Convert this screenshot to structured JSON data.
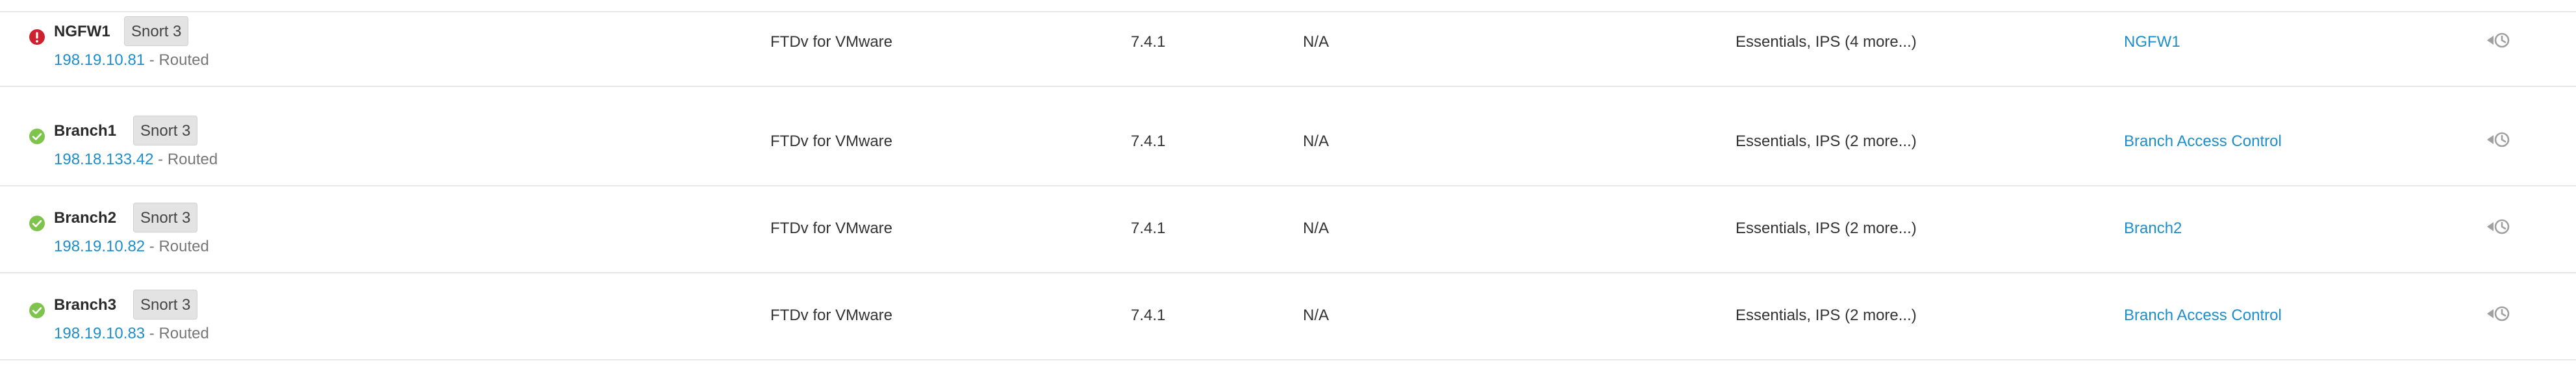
{
  "devices": [
    {
      "status": "ok",
      "name": "Branch1",
      "snort_badge": "Snort 3",
      "ip": "198.18.133.42",
      "separator": " - ",
      "mode": "Routed",
      "model": "FTDv for VMware",
      "version": "7.4.1",
      "chassis": "N/A",
      "licenses": "Essentials, IPS (2 more...)",
      "access_policy": "Branch Access Control"
    },
    {
      "status": "ok",
      "name": "Branch2",
      "snort_badge": "Snort 3",
      "ip": "198.19.10.82",
      "separator": " - ",
      "mode": "Routed",
      "model": "FTDv for VMware",
      "version": "7.4.1",
      "chassis": "N/A",
      "licenses": "Essentials, IPS (2 more...)",
      "access_policy": "Branch2"
    },
    {
      "status": "ok",
      "name": "Branch3",
      "snort_badge": "Snort 3",
      "ip": "198.19.10.83",
      "separator": " - ",
      "mode": "Routed",
      "model": "FTDv for VMware",
      "version": "7.4.1",
      "chassis": "N/A",
      "licenses": "Essentials, IPS (2 more...)",
      "access_policy": "Branch Access Control"
    },
    {
      "status": "error",
      "name": "NGFW1",
      "snort_badge": "Snort 3",
      "ip": "198.19.10.81",
      "separator": " - ",
      "mode": "Routed",
      "model": "FTDv for VMware",
      "version": "7.4.1",
      "chassis": "N/A",
      "licenses": "Essentials, IPS (4 more...)",
      "access_policy": "NGFW1"
    }
  ],
  "icons": {
    "ok": "check-circle-icon",
    "error": "alert-circle-icon",
    "history": "revert-history-icon"
  },
  "colors": {
    "ok": "#7ec34b",
    "error": "#cf2030",
    "link": "#1d8ecb",
    "history_icon": "#a0a0a0"
  }
}
